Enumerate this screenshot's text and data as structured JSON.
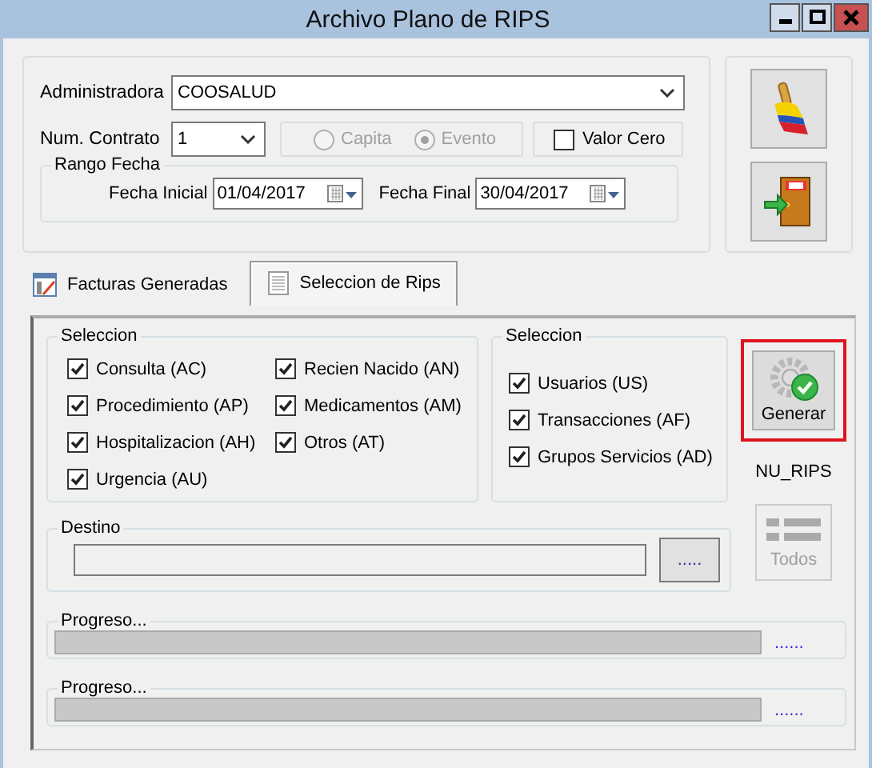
{
  "window": {
    "title": "Archivo Plano de RIPS"
  },
  "form": {
    "administradora": {
      "label": "Administradora",
      "value": "COOSALUD"
    },
    "contrato": {
      "label": "Num. Contrato",
      "value": "1"
    },
    "modalidad": {
      "disabled": true,
      "options": [
        {
          "label": "Capita",
          "selected": false
        },
        {
          "label": "Evento",
          "selected": true
        }
      ]
    },
    "valor_cero": {
      "label": "Valor Cero",
      "checked": false
    },
    "rango_fecha": {
      "title": "Rango Fecha",
      "fechas": [
        {
          "label": "Fecha Inicial",
          "value": "01/04/2017"
        },
        {
          "label": "Fecha Final",
          "value": "30/04/2017"
        }
      ]
    }
  },
  "tabs": [
    {
      "label": "Facturas Generadas",
      "selected": false
    },
    {
      "label": "Seleccion de Rips",
      "selected": true
    }
  ],
  "seleccion": [
    {
      "title": "Seleccion",
      "items": [
        {
          "label": "Consulta (AC)",
          "checked": true
        },
        {
          "label": "Procedimiento (AP)",
          "checked": true
        },
        {
          "label": "Hospitalizacion (AH)",
          "checked": true
        },
        {
          "label": "Urgencia (AU)",
          "checked": true
        },
        {
          "label": "Recien Nacido (AN)",
          "checked": true
        },
        {
          "label": "Medicamentos (AM)",
          "checked": true
        },
        {
          "label": "Otros (AT)",
          "checked": true
        }
      ]
    },
    {
      "title": "Seleccion",
      "items": [
        {
          "label": "Usuarios (US)",
          "checked": true
        },
        {
          "label": "Transacciones (AF)",
          "checked": true
        },
        {
          "label": "Grupos Servicios (AD)",
          "checked": true
        }
      ]
    }
  ],
  "generar": {
    "label": "Generar",
    "highlighted": true
  },
  "nu_rips": "NU_RIPS",
  "todos": {
    "label": "Todos",
    "disabled": true
  },
  "destino": {
    "title": "Destino",
    "button": "....."
  },
  "progress": [
    {
      "title": "Progreso...",
      "level": 0,
      "link": "......"
    },
    {
      "title": "Progreso...",
      "level": 0,
      "link": "......"
    }
  ]
}
